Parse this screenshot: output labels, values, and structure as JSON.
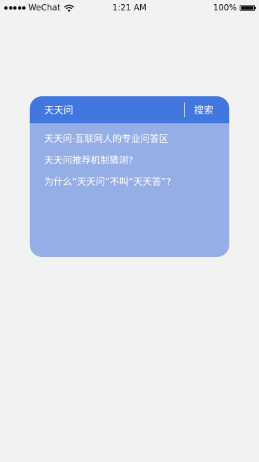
{
  "status_bar": {
    "carrier": "WeChat",
    "time": "1:21 AM",
    "battery": "100%"
  },
  "card": {
    "title": "天天问",
    "search_label": "搜索",
    "suggestions": [
      "天天问·互联网人的专业问答区",
      "天天问推荐机制猜测?",
      "为什么“天天问”不叫“天天答”?"
    ]
  },
  "colors": {
    "background": "#f2f2f2",
    "card_header": "#4377e0",
    "card_body": "#96aee6",
    "text_on_card": "#ffffff"
  },
  "icons": [
    "signal-dots-icon",
    "wifi-icon",
    "battery-icon"
  ]
}
